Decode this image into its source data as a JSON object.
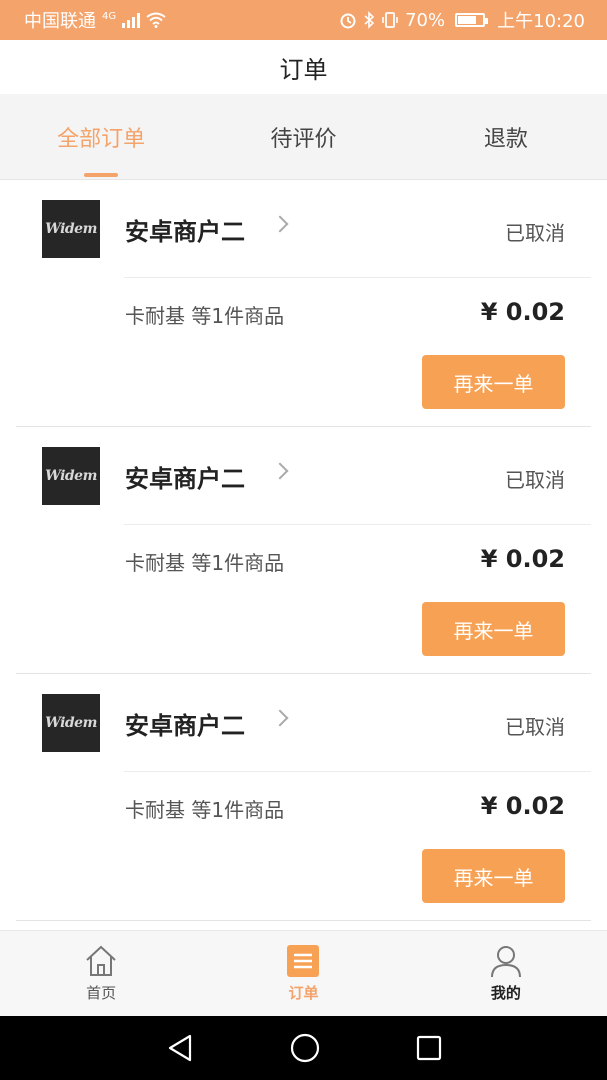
{
  "status_bar": {
    "carrier": "中国联通",
    "network": "4G",
    "battery_level": "70%",
    "time": "上午10:20"
  },
  "page_title": "订单",
  "tabs": [
    {
      "label": "全部订单",
      "active": true
    },
    {
      "label": "待评价",
      "active": false
    },
    {
      "label": "退款",
      "active": false
    }
  ],
  "orders": [
    {
      "logo_text": "Widem",
      "shop_name": "安卓商户二",
      "status": "已取消",
      "items_summary": "卡耐基  等1件商品",
      "price": "¥ 0.02",
      "reorder_label": "再来一单"
    },
    {
      "logo_text": "Widem",
      "shop_name": "安卓商户二",
      "status": "已取消",
      "items_summary": "卡耐基  等1件商品",
      "price": "¥ 0.02",
      "reorder_label": "再来一单"
    },
    {
      "logo_text": "Widem",
      "shop_name": "安卓商户二",
      "status": "已取消",
      "items_summary": "卡耐基  等1件商品",
      "price": "¥ 0.02",
      "reorder_label": "再来一单"
    }
  ],
  "bottom_nav": [
    {
      "label": "首页",
      "icon": "home-icon"
    },
    {
      "label": "订单",
      "icon": "list-icon",
      "active": true
    },
    {
      "label": "我的",
      "icon": "person-icon"
    }
  ],
  "colors": {
    "accent": "#f4a36a",
    "button": "#f7a155"
  }
}
